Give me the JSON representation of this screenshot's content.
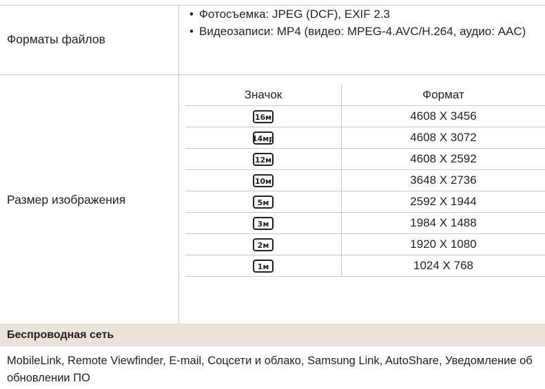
{
  "file_formats": {
    "label": "Форматы файлов",
    "items": [
      "Фотосъемка: JPEG (DCF), EXIF 2.3",
      "Видеозаписи: MP4 (видео: MPEG-4.AVC/H.264, аудио: AAC)"
    ]
  },
  "image_size": {
    "label": "Размер изображения",
    "col_icon": "Значок",
    "col_format": "Формат",
    "rows": [
      {
        "icon": "16m-size-icon",
        "icon_text": "16м",
        "format": "4608 X 3456"
      },
      {
        "icon": "14m-size-icon",
        "icon_text": "14мp",
        "format": "4608 X 3072"
      },
      {
        "icon": "12m-size-icon",
        "icon_text": "12м",
        "format": "4608 X 2592"
      },
      {
        "icon": "10m-size-icon",
        "icon_text": "10м",
        "format": "3648 X 2736"
      },
      {
        "icon": "5m-size-icon",
        "icon_text": "5м",
        "format": "2592 X 1944"
      },
      {
        "icon": "3m-size-icon",
        "icon_text": "3м",
        "format": "1984 X 1488"
      },
      {
        "icon": "2m-size-icon",
        "icon_text": "2м",
        "format": "1920 X 1080"
      },
      {
        "icon": "1m-size-icon",
        "icon_text": "1м",
        "format": "1024 X 768"
      }
    ]
  },
  "wireless": {
    "title": "Беспроводная сеть",
    "text": "MobileLink, Remote Viewfinder, E-mail, Соцсети и облако, Samsung Link, AutoShare, Уведомление об обновлении ПО"
  },
  "colors": {
    "header_bg": "#e9e2d9",
    "rule": "#c9c5c3",
    "text": "#231f20"
  }
}
